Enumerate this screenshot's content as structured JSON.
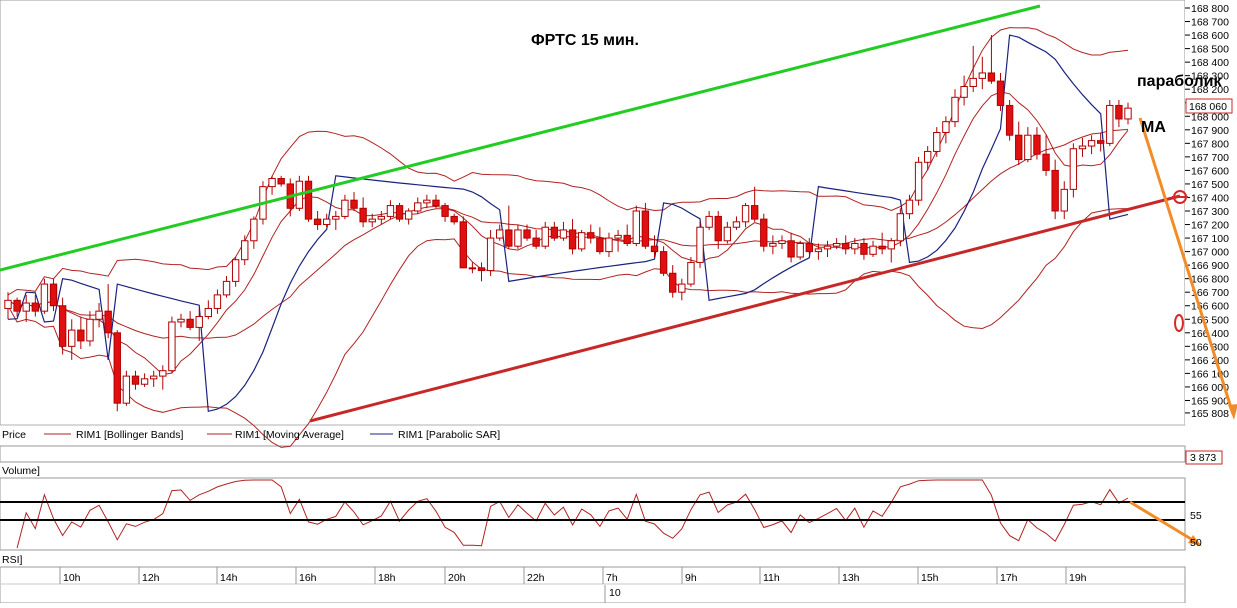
{
  "chart_data": {
    "type": "candlestick",
    "title": "ФРТС   15 мин.",
    "annotations": {
      "parabolic": "параболик",
      "ma": "МА",
      "zero": "0"
    },
    "price_axis": {
      "ticks": [
        "168 800",
        "168 700",
        "168 600",
        "168 500",
        "168 400",
        "168 300",
        "168 200",
        "168 100",
        "168 000",
        "167 900",
        "167 800",
        "167 700",
        "167 600",
        "167 500",
        "167 400",
        "167 300",
        "167 200",
        "167 100",
        "167 000",
        "166 900",
        "166 800",
        "166 700",
        "166 600",
        "166 500",
        "166 400",
        "166 300",
        "166 200",
        "166 100",
        "166 000",
        "165 900",
        "165 808"
      ],
      "ylim": [
        165800,
        168800
      ],
      "last_price_label": "168 060",
      "last_price": 168060
    },
    "legend": [
      {
        "label": "Price",
        "color": "#000000"
      },
      {
        "label": "RIM1 [Bollinger Bands]",
        "color": "#b22222"
      },
      {
        "label": "RIM1 [Moving Average]",
        "color": "#b22222"
      },
      {
        "label": "RIM1 [Parabolic SAR]",
        "color": "#1a237e"
      }
    ],
    "volume": {
      "label": "Volume]",
      "last_value_label": "3 873"
    },
    "rsi": {
      "label": "RSI]",
      "ticks": [
        "55",
        "50"
      ],
      "levels": [
        "upper",
        "lower"
      ]
    },
    "time_axis": {
      "labels": [
        "10h",
        "12h",
        "14h",
        "16h",
        "18h",
        "20h",
        "22h",
        "7h",
        "9h",
        "11h",
        "13h",
        "15h",
        "17h",
        "19h"
      ],
      "date_label": "10"
    },
    "candles": [
      [
        166580,
        166700,
        166500,
        166640
      ],
      [
        166640,
        166660,
        166520,
        166560
      ],
      [
        166560,
        166680,
        166480,
        166620
      ],
      [
        166620,
        166680,
        166520,
        166560
      ],
      [
        166560,
        166800,
        166540,
        166760
      ],
      [
        166760,
        166800,
        166560,
        166600
      ],
      [
        166600,
        166660,
        166240,
        166300
      ],
      [
        166300,
        166500,
        166200,
        166420
      ],
      [
        166420,
        166520,
        166280,
        166340
      ],
      [
        166340,
        166560,
        166300,
        166500
      ],
      [
        166500,
        166620,
        166440,
        166560
      ],
      [
        166560,
        166760,
        166360,
        166400
      ],
      [
        166400,
        166420,
        165820,
        165880
      ],
      [
        165880,
        166120,
        165860,
        166080
      ],
      [
        166080,
        166120,
        165980,
        166020
      ],
      [
        166020,
        166100,
        166000,
        166060
      ],
      [
        166060,
        166120,
        166000,
        166080
      ],
      [
        166080,
        166160,
        165980,
        166120
      ],
      [
        166120,
        166520,
        166100,
        166480
      ],
      [
        166480,
        166540,
        166440,
        166500
      ],
      [
        166500,
        166560,
        166420,
        166440
      ],
      [
        166440,
        166580,
        166340,
        166520
      ],
      [
        166520,
        166640,
        166500,
        166580
      ],
      [
        166580,
        166720,
        166540,
        166680
      ],
      [
        166680,
        166820,
        166660,
        166780
      ],
      [
        166780,
        166960,
        166740,
        166940
      ],
      [
        166940,
        167120,
        166900,
        167080
      ],
      [
        167080,
        167260,
        167020,
        167240
      ],
      [
        167240,
        167520,
        167200,
        167480
      ],
      [
        167480,
        167560,
        167420,
        167540
      ],
      [
        167540,
        167560,
        167480,
        167500
      ],
      [
        167500,
        167540,
        167260,
        167320
      ],
      [
        167320,
        167560,
        167300,
        167520
      ],
      [
        167520,
        167560,
        167220,
        167240
      ],
      [
        167240,
        167300,
        167160,
        167200
      ],
      [
        167200,
        167280,
        167180,
        167240
      ],
      [
        167240,
        167300,
        167160,
        167260
      ],
      [
        167260,
        167420,
        167240,
        167380
      ],
      [
        167380,
        167440,
        167300,
        167320
      ],
      [
        167320,
        167400,
        167180,
        167220
      ],
      [
        167220,
        167280,
        167180,
        167240
      ],
      [
        167240,
        167300,
        167200,
        167260
      ],
      [
        167260,
        167380,
        167240,
        167340
      ],
      [
        167340,
        167360,
        167220,
        167240
      ],
      [
        167240,
        167320,
        167200,
        167300
      ],
      [
        167300,
        167400,
        167280,
        167360
      ],
      [
        167360,
        167420,
        167320,
        167380
      ],
      [
        167380,
        167420,
        167320,
        167340
      ],
      [
        167340,
        167360,
        167220,
        167260
      ],
      [
        167260,
        167280,
        167200,
        167220
      ],
      [
        167220,
        167260,
        166940,
        166880
      ],
      [
        166880,
        166920,
        166840,
        166880
      ],
      [
        166880,
        166920,
        166780,
        166860
      ],
      [
        166860,
        167160,
        166820,
        167100
      ],
      [
        167100,
        167200,
        167080,
        167160
      ],
      [
        167160,
        167340,
        167020,
        167040
      ],
      [
        167040,
        167200,
        167020,
        167160
      ],
      [
        167160,
        167200,
        167080,
        167100
      ],
      [
        167100,
        167160,
        167020,
        167040
      ],
      [
        167040,
        167220,
        167020,
        167180
      ],
      [
        167180,
        167220,
        167080,
        167100
      ],
      [
        167100,
        167220,
        167080,
        167160
      ],
      [
        167160,
        167240,
        166980,
        167020
      ],
      [
        167020,
        167160,
        167000,
        167140
      ],
      [
        167140,
        167200,
        167060,
        167100
      ],
      [
        167100,
        167180,
        166980,
        167000
      ],
      [
        167000,
        167140,
        166960,
        167100
      ],
      [
        167100,
        167160,
        167000,
        167120
      ],
      [
        167120,
        167200,
        167040,
        167060
      ],
      [
        167060,
        167340,
        167040,
        167300
      ],
      [
        167300,
        167360,
        167020,
        167040
      ],
      [
        167040,
        167120,
        166960,
        167000
      ],
      [
        167000,
        167040,
        166820,
        166840
      ],
      [
        166840,
        166900,
        166660,
        166700
      ],
      [
        166700,
        166800,
        166640,
        166760
      ],
      [
        166760,
        166960,
        166740,
        166920
      ],
      [
        166920,
        167220,
        166880,
        167180
      ],
      [
        167180,
        167300,
        167160,
        167260
      ],
      [
        167260,
        167300,
        167020,
        167080
      ],
      [
        167080,
        167220,
        167060,
        167180
      ],
      [
        167180,
        167260,
        167160,
        167220
      ],
      [
        167220,
        167360,
        167180,
        167340
      ],
      [
        167340,
        167480,
        167220,
        167240
      ],
      [
        167240,
        167280,
        167000,
        167040
      ],
      [
        167040,
        167120,
        166980,
        167060
      ],
      [
        167060,
        167120,
        167020,
        167080
      ],
      [
        167080,
        167140,
        166920,
        166960
      ],
      [
        166960,
        167080,
        166940,
        167060
      ],
      [
        167060,
        167100,
        166980,
        167000
      ],
      [
        167000,
        167060,
        166940,
        167020
      ],
      [
        167020,
        167080,
        166960,
        167040
      ],
      [
        167040,
        167100,
        167020,
        167060
      ],
      [
        167060,
        167120,
        166980,
        167020
      ],
      [
        167020,
        167100,
        166980,
        167060
      ],
      [
        167060,
        167100,
        166940,
        166980
      ],
      [
        166980,
        167080,
        166960,
        167040
      ],
      [
        167040,
        167140,
        166980,
        167020
      ],
      [
        167020,
        167100,
        166920,
        167080
      ],
      [
        167080,
        167320,
        167040,
        167280
      ],
      [
        167280,
        167420,
        167240,
        167380
      ],
      [
        167380,
        167700,
        167340,
        167660
      ],
      [
        167660,
        167780,
        167600,
        167740
      ],
      [
        167740,
        167920,
        167700,
        167880
      ],
      [
        167880,
        168000,
        167800,
        167960
      ],
      [
        167960,
        168200,
        167920,
        168140
      ],
      [
        168140,
        168300,
        168080,
        168220
      ],
      [
        168220,
        168520,
        168180,
        168280
      ],
      [
        168280,
        168440,
        168200,
        168320
      ],
      [
        168320,
        168600,
        168240,
        168260
      ],
      [
        168260,
        168320,
        168040,
        168080
      ],
      [
        168080,
        168120,
        167820,
        167860
      ],
      [
        167860,
        167960,
        167640,
        167680
      ],
      [
        167680,
        167920,
        167660,
        167860
      ],
      [
        167860,
        167920,
        167680,
        167720
      ],
      [
        167720,
        167860,
        167560,
        167600
      ],
      [
        167600,
        167680,
        167240,
        167300
      ],
      [
        167300,
        167520,
        167240,
        167460
      ],
      [
        167460,
        167800,
        167400,
        167760
      ],
      [
        167760,
        167840,
        167700,
        167780
      ],
      [
        167780,
        167860,
        167720,
        167820
      ],
      [
        167820,
        167880,
        167740,
        167800
      ],
      [
        167800,
        168120,
        167780,
        168080
      ],
      [
        168080,
        168120,
        167920,
        167980
      ],
      [
        167980,
        168100,
        167940,
        168060
      ]
    ]
  }
}
